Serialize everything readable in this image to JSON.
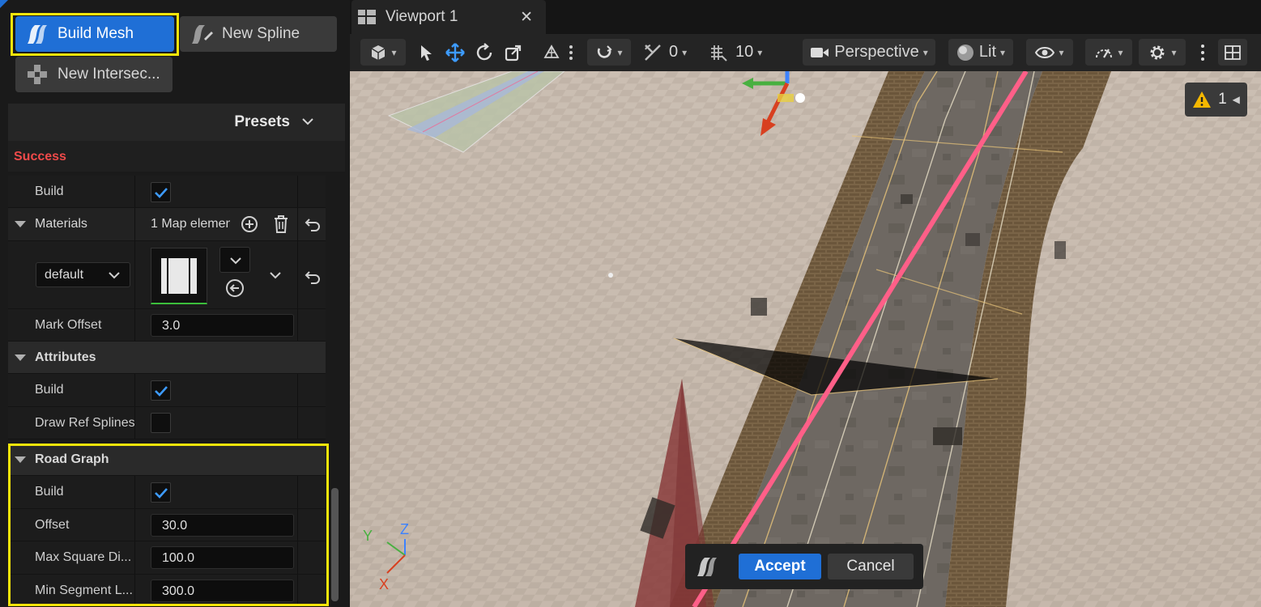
{
  "left_panel": {
    "toolbar": {
      "build_mesh_label": "Build Mesh",
      "new_spline_label": "New Spline",
      "new_intersection_label": "New Intersec..."
    },
    "presets_label": "Presets",
    "status_text": "Success",
    "build_row": {
      "label": "Build",
      "checked": true
    },
    "materials": {
      "label": "Materials",
      "summary": "1 Map elemen",
      "key_dropdown": "default"
    },
    "mark_offset": {
      "label": "Mark Offset",
      "value": "3.0"
    },
    "attributes": {
      "label": "Attributes",
      "build_label": "Build",
      "draw_ref_splines_label": "Draw Ref Splines"
    },
    "road_graph": {
      "label": "Road Graph",
      "build_label": "Build",
      "offset_label": "Offset",
      "offset_value": "30.0",
      "max_square_label": "Max Square Di...",
      "max_square_value": "100.0",
      "min_segment_label": "Min Segment L...",
      "min_segment_value": "300.0"
    }
  },
  "viewport": {
    "tab_title": "Viewport 1",
    "toolbar": {
      "angle_snap_value": "0",
      "grid_snap_value": "10",
      "view_mode": "Perspective",
      "lighting_mode": "Lit"
    },
    "warning_count": "1",
    "axis_labels": {
      "x": "X",
      "y": "Y",
      "z": "Z"
    },
    "confirm": {
      "accept_label": "Accept",
      "cancel_label": "Cancel"
    }
  },
  "colors": {
    "accent_blue": "#1f6fd6",
    "highlight_yellow": "#f5e50a",
    "status_red": "#f04a4a",
    "warning_yellow": "#f5b800"
  }
}
